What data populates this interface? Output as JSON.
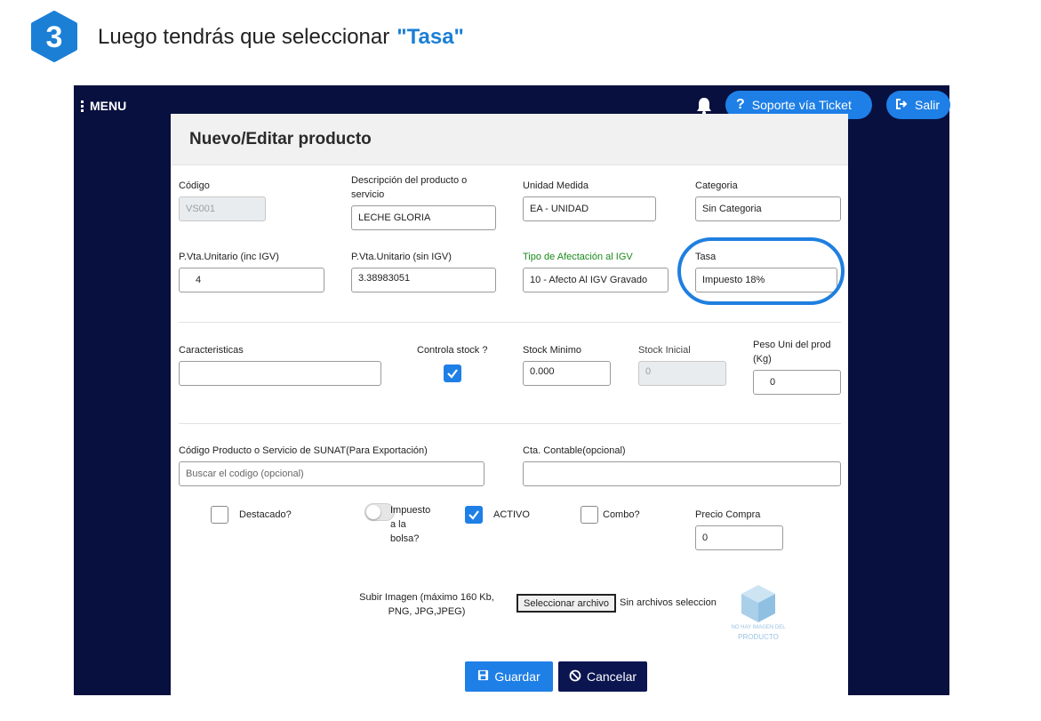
{
  "step": {
    "number": "3",
    "text": "Luego tendrás que seleccionar",
    "highlight": "\"Tasa\""
  },
  "navbar": {
    "menu_label": "MENU",
    "ticket_label": "Soporte vía Ticket",
    "salir_label": "Salir"
  },
  "modal": {
    "title": "Nuevo/Editar producto",
    "fields": {
      "codigo": {
        "label": "Código",
        "value": "VS001"
      },
      "descripcion": {
        "label": "Descripción del producto o servicio",
        "value": "LECHE GLORIA"
      },
      "unidad": {
        "label": "Unidad Medida",
        "value": "EA - UNIDAD"
      },
      "categoria": {
        "label": "Categoria",
        "value": "Sin Categoria"
      },
      "pvta_inc": {
        "label": "P.Vta.Unitario (inc IGV)",
        "value": "4"
      },
      "pvta_sin": {
        "label": "P.Vta.Unitario (sin IGV)",
        "value": "3.38983051"
      },
      "afectacion": {
        "label": "Tipo de Afectación al IGV",
        "value": "10 - Afecto Al IGV Gravado"
      },
      "tasa": {
        "label": "Tasa",
        "value": "Impuesto 18%"
      },
      "caracteristicas": {
        "label": "Caracteristicas",
        "value": ""
      },
      "controla_stock": {
        "label": "Controla stock ?",
        "checked": true
      },
      "stock_minimo": {
        "label": "Stock Minimo",
        "value": "0.000"
      },
      "stock_inicial": {
        "label": "Stock Inicial",
        "value": "0"
      },
      "peso": {
        "label": "Peso Uni del prod (Kg)",
        "value": "0"
      },
      "codigo_sunat": {
        "label": "Código Producto o Servicio de SUNAT(Para Exportación)",
        "placeholder": "Buscar el codigo (opcional)"
      },
      "cta_contable": {
        "label": "Cta. Contable(opcional)",
        "value": ""
      },
      "destacado": {
        "label": "Destacado?",
        "checked": false
      },
      "impuesto_bolsa": {
        "label": "Impuesto a la bolsa?",
        "on": false
      },
      "activo": {
        "label": "ACTIVO",
        "checked": true
      },
      "combo": {
        "label": "Combo?",
        "checked": false
      },
      "precio_compra": {
        "label": "Precio Compra",
        "value": "0"
      }
    },
    "upload": {
      "label": "Subir Imagen (máximo 160 Kb, PNG, JPG,JPEG)",
      "button": "Seleccionar archivo",
      "status": "Sin archivos seleccion",
      "no_image_line1": "NO HAY IMAGEN DEL",
      "no_image_line2": "PRODUCTO"
    },
    "actions": {
      "save": "Guardar",
      "cancel": "Cancelar"
    }
  },
  "colors": {
    "accent": "#1e7fe6",
    "navy": "#07103e",
    "highlight_text": "#1b7fd6",
    "green_label": "#1a8a1a"
  }
}
